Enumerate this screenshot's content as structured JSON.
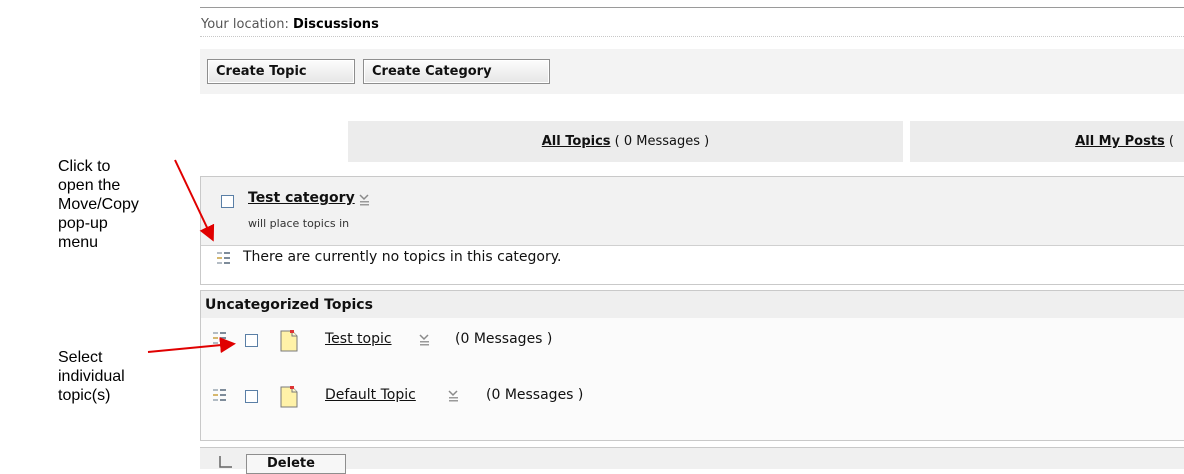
{
  "annotations": {
    "move_copy": [
      "Click to",
      "open the",
      "Move/Copy",
      "pop-up",
      "menu"
    ],
    "select_topics": [
      "Select",
      "individual",
      "topic(s)"
    ]
  },
  "location": {
    "label": "Your location:",
    "value": "Discussions"
  },
  "toolbar": {
    "create_topic": "Create Topic",
    "create_category": "Create Category"
  },
  "tabs": {
    "all_topics": {
      "label": "All Topics",
      "count": "( 0 Messages )"
    },
    "all_my_posts": {
      "label": "All My Posts",
      "suffix": "("
    }
  },
  "category": {
    "title": "Test category",
    "description": "will place topics in",
    "empty_message": "There are currently no topics in this category."
  },
  "uncategorized": {
    "title": "Uncategorized Topics",
    "topics": [
      {
        "name": "Test topic",
        "count": "(0 Messages )"
      },
      {
        "name": "Default Topic",
        "count": "(0 Messages )"
      }
    ]
  },
  "bottom": {
    "delete_label": "Delete"
  },
  "colors": {
    "annotation_arrow": "#e00000",
    "checkbox_border": "#5a7fa6",
    "panel_gray": "#f2f2f2"
  }
}
